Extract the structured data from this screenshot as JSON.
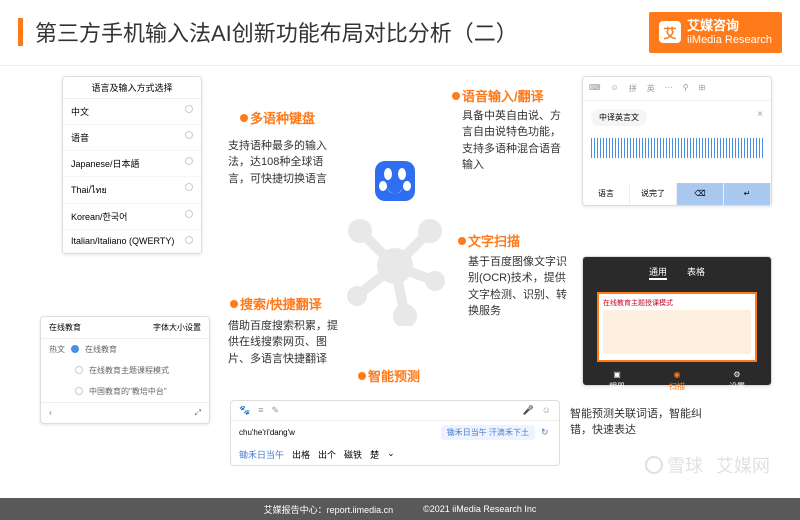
{
  "header": {
    "title": "第三方手机输入法AI创新功能布局对比分析（二）",
    "brand_cn": "艾媒咨询",
    "brand_en": "iiMedia Research"
  },
  "features": {
    "multilang": {
      "title": "多语种键盘",
      "desc": "支持语种最多的输入法，达108种全球语言，可快捷切换语言"
    },
    "voice": {
      "title": "语音输入/翻译",
      "desc": "具备中英自由说、方言自由说特色功能，支持多语种混合语音输入"
    },
    "search": {
      "title": "搜索/快捷翻译",
      "desc": "借助百度搜索积累，提供在线搜索网页、图片、多语言快捷翻译"
    },
    "ocr": {
      "title": "文字扫描",
      "desc": "基于百度图像文字识别(OCR)技术，提供文字检测、识别、转换服务"
    },
    "predict": {
      "title": "智能预测",
      "desc": "智能预测关联词语，智能纠错，快速表达"
    }
  },
  "lang_panel": {
    "header": "语言及输入方式选择",
    "items": [
      "中文",
      "语音",
      "Japanese/日本語",
      "Thai/ไทย",
      "Korean/한국어",
      "Italian/Italiano (QWERTY)"
    ]
  },
  "search_panel": {
    "tab1": "在线教育",
    "tab2": "字体大小设置",
    "left1": "热文",
    "opt1": "在线教育",
    "opt2": "在线教育主题课程模式",
    "opt3": "中国教育的\"教培中台\""
  },
  "voice_panel": {
    "tabs": [
      "拼",
      "英"
    ],
    "pill": "中译英言文",
    "done": "说完了"
  },
  "ocr_panel": {
    "tab_active": "通用",
    "tab_other": "表格",
    "inner_title": "在线教育主题授课模式",
    "bot1": "相册",
    "bot2": "扫描",
    "bot3": "设置"
  },
  "ime": {
    "pinyin": "chu'he'ri'dang'w",
    "suggestion": "锄禾日当午 汗滴禾下土",
    "candidates": [
      "锄禾日当午",
      "出格",
      "出个",
      "磁铁",
      "楚"
    ]
  },
  "footer": {
    "src": "艾媒报告中心：report.iimedia.cn",
    "copy": "©2021 iiMedia Research Inc",
    "wm1": "雪球",
    "wm2": "艾媒网"
  }
}
